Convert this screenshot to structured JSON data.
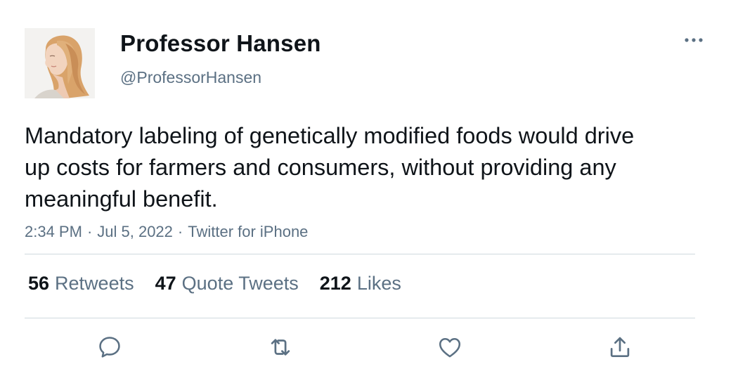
{
  "author": {
    "display_name": "Professor Hansen",
    "handle": "@ProfessorHansen",
    "avatar_icon": "profile-photo-woman"
  },
  "tweet": {
    "text": "Mandatory labeling of genetically modified foods would drive up costs for farmers and consumers, without providing any meaningful benefit.",
    "time": "2:34 PM",
    "date": "Jul 5, 2022",
    "source": "Twitter for iPhone",
    "separator": "·"
  },
  "stats": {
    "retweets_count": "56",
    "retweets_label": "Retweets",
    "quotes_count": "47",
    "quotes_label": "Quote Tweets",
    "likes_count": "212",
    "likes_label": "Likes"
  },
  "actions": {
    "reply_icon": "reply-icon",
    "retweet_icon": "retweet-icon",
    "like_icon": "heart-icon",
    "share_icon": "share-icon",
    "more_icon": "more-dots-icon"
  },
  "colors": {
    "text_primary": "#0f1419",
    "text_secondary": "#5b7083",
    "divider": "#cfd9de",
    "icon": "#5b7083"
  }
}
